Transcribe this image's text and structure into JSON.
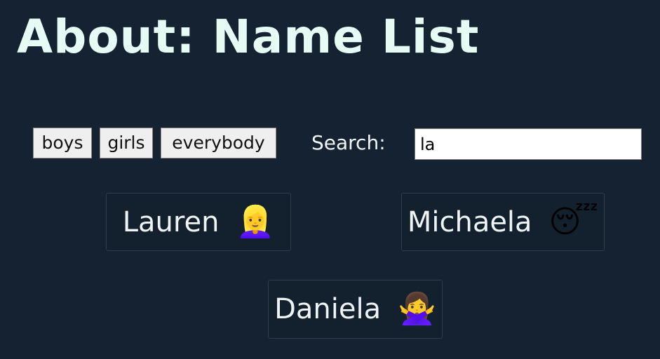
{
  "header": {
    "title": "About: Name List"
  },
  "filters": {
    "buttons": [
      {
        "label": "boys"
      },
      {
        "label": "girls"
      },
      {
        "label": "everybody"
      }
    ]
  },
  "search": {
    "label": "Search:",
    "value": "la"
  },
  "results": [
    {
      "name": "Lauren",
      "emoji": "👱‍♀️",
      "icon": "blonde-woman-emoji"
    },
    {
      "name": "Michaela",
      "emoji": "😴",
      "icon": "sleeping-face-emoji"
    },
    {
      "name": "Daniela",
      "emoji": "🙅‍♀️",
      "icon": "woman-gesturing-no-emoji"
    }
  ]
}
